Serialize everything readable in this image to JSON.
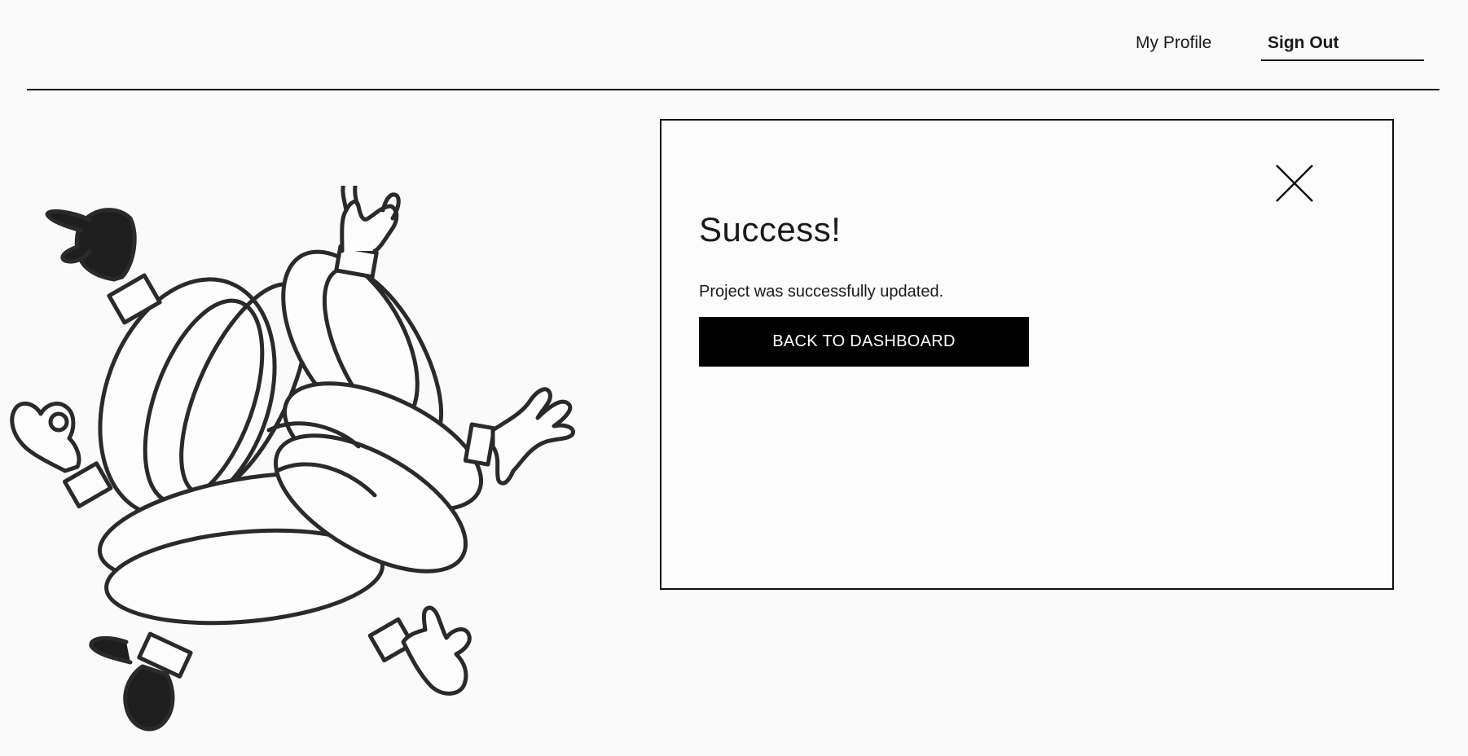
{
  "nav": {
    "my_profile_label": "My Profile",
    "sign_out_label": "Sign Out"
  },
  "modal": {
    "title": "Success!",
    "message": "Project was successfully updated.",
    "back_button_label": "BACK TO DASHBOARD",
    "close_icon": "close-icon"
  },
  "illustration": {
    "icon": "arms-knot-illustration"
  },
  "colors": {
    "background": "#fafafa",
    "text": "#111111",
    "button_bg": "#000000",
    "button_text": "#ffffff"
  }
}
